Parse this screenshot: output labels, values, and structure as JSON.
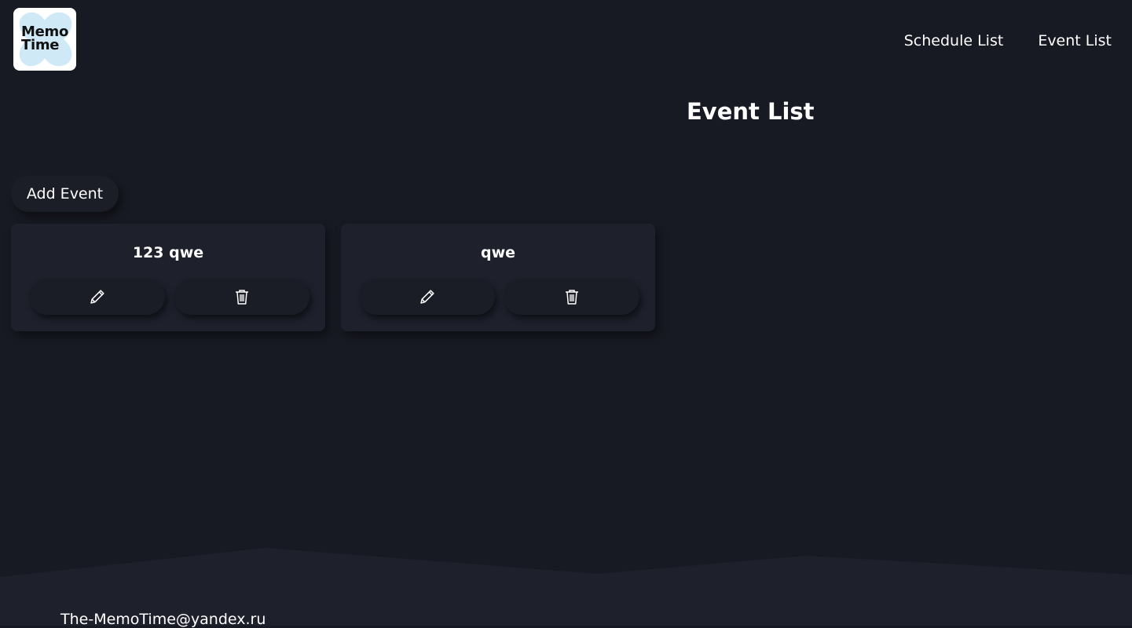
{
  "logo": {
    "line1": "Memo",
    "line2": "Time"
  },
  "nav": {
    "items": [
      {
        "label": "Schedule List"
      },
      {
        "label": "Event List"
      }
    ]
  },
  "page": {
    "title": "Event List"
  },
  "toolbar": {
    "add_label": "Add Event"
  },
  "events": [
    {
      "title": "123 qwe",
      "edit_icon": "pencil-icon",
      "delete_icon": "trash-icon"
    },
    {
      "title": "qwe",
      "edit_icon": "pencil-icon",
      "delete_icon": "trash-icon"
    }
  ],
  "footer": {
    "email": "The-MemoTime@yandex.ru"
  },
  "colors": {
    "background": "#181a23",
    "card": "#1e202c",
    "footer": "#1e202c",
    "logo_accent": "#cfeaf6",
    "text": "#ffffff"
  }
}
